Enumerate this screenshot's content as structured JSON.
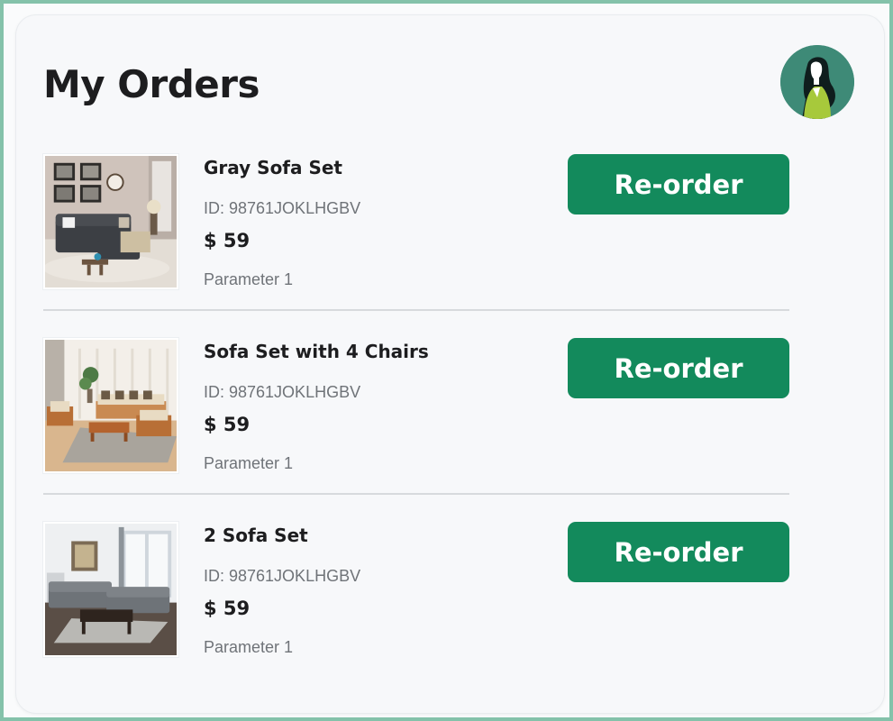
{
  "page": {
    "title": "My Orders"
  },
  "orders": [
    {
      "name": "Gray Sofa Set",
      "id": "ID: 98761JOKLHGBV",
      "price": "$ 59",
      "parameter": "Parameter 1",
      "button_label": "Re-order"
    },
    {
      "name": "Sofa Set with 4 Chairs",
      "id": "ID: 98761JOKLHGBV",
      "price": "$ 59",
      "parameter": "Parameter 1",
      "button_label": "Re-order"
    },
    {
      "name": "2 Sofa Set",
      "id": "ID: 98761JOKLHGBV",
      "price": "$ 59",
      "parameter": "Parameter 1",
      "button_label": "Re-order"
    }
  ],
  "colors": {
    "accent": "#138a5c",
    "frame": "#84c2aa",
    "card": "#f7f8fa",
    "avatar_bg": "#3e8a77"
  },
  "icons": {
    "avatar": "woman-avatar-icon"
  }
}
